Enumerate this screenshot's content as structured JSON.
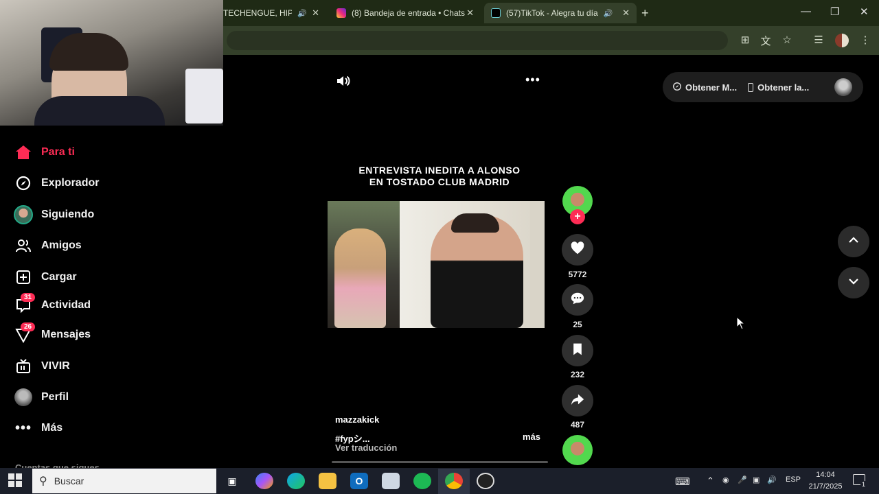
{
  "browser": {
    "tabs": [
      {
        "title": "TECHENGUE, HIP HO",
        "active": false
      },
      {
        "title": "(8) Bandeja de entrada • Chats",
        "active": false
      },
      {
        "title": "(57)TikTok - Alegra tu día",
        "active": true
      }
    ],
    "new_tab_glyph": "+"
  },
  "sidebar": {
    "items": [
      {
        "label": "Para ti",
        "icon": "home-icon",
        "active": true
      },
      {
        "label": "Explorador",
        "icon": "compass-icon"
      },
      {
        "label": "Siguiendo",
        "icon": "following-avatar"
      },
      {
        "label": "Amigos",
        "icon": "friends-icon"
      },
      {
        "label": "Cargar",
        "icon": "upload-icon"
      },
      {
        "label": "Actividad",
        "icon": "activity-icon",
        "badge": "31"
      },
      {
        "label": "Mensajes",
        "icon": "messages-icon",
        "badge": "26"
      },
      {
        "label": "VIVIR",
        "icon": "live-icon"
      },
      {
        "label": "Perfil",
        "icon": "profile-avatar"
      },
      {
        "label": "Más",
        "icon": "more-icon"
      }
    ],
    "following_heading": "Cuentas que sigues"
  },
  "video": {
    "title_line1": "ENTREVISTA INEDITA A ALONSO",
    "title_line2": "EN TOSTADO CLUB MADRID",
    "author": "mazzakick",
    "caption": "#fypシ...",
    "more_label": "más",
    "translate_label": "Ver traducción"
  },
  "actions": {
    "likes": "5772",
    "comments": "25",
    "saves": "232",
    "shares": "487"
  },
  "top_right": {
    "get_app_label": "Obtener M...",
    "get_desktop_label": "Obtener la..."
  },
  "taskbar": {
    "search_placeholder": "Buscar",
    "language": "ESP",
    "time": "14:04",
    "date": "21/7/2025",
    "notifications": "1"
  },
  "colors": {
    "accent": "#fe2c55",
    "chrome_bg": "#1f2a15",
    "toolbar_bg": "#34402a"
  }
}
